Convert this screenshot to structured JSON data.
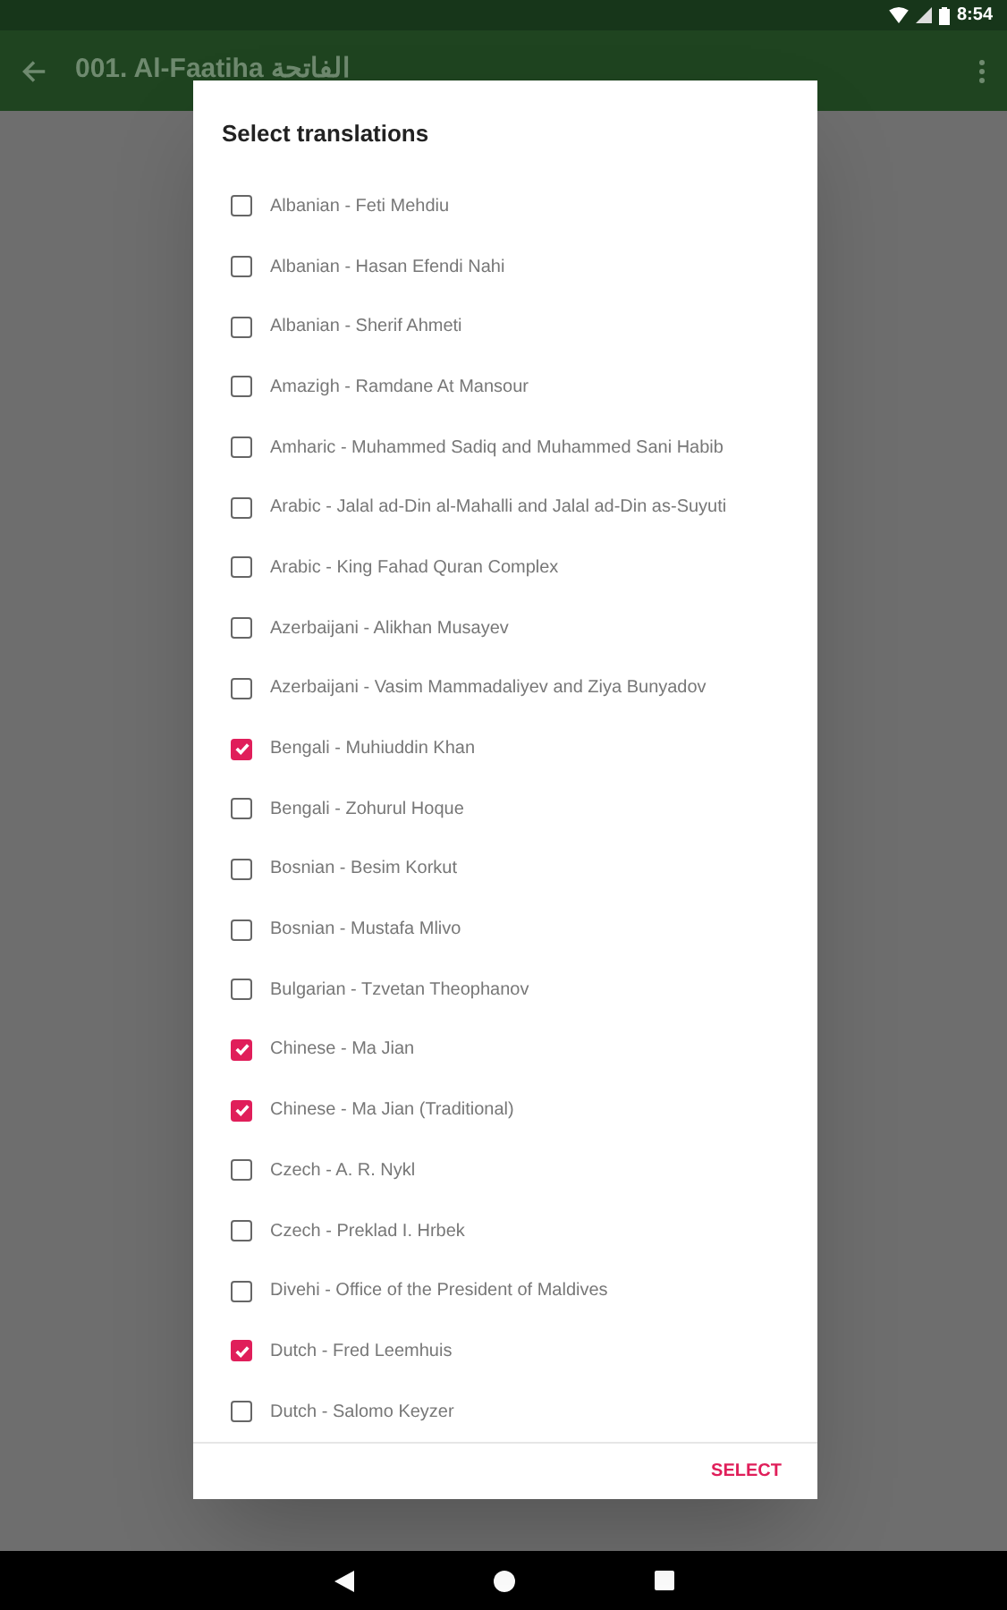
{
  "status_bar": {
    "time": "8:54"
  },
  "app_bar": {
    "title": "001. Al-Faatiha الفاتحة"
  },
  "dialog": {
    "title": "Select translations",
    "items": [
      {
        "label": "Albanian - Feti Mehdiu",
        "checked": false
      },
      {
        "label": "Albanian - Hasan Efendi Nahi",
        "checked": false
      },
      {
        "label": "Albanian - Sherif Ahmeti",
        "checked": false
      },
      {
        "label": "Amazigh - Ramdane At Mansour",
        "checked": false
      },
      {
        "label": "Amharic - Muhammed Sadiq and Muhammed Sani Habib",
        "checked": false
      },
      {
        "label": "Arabic - Jalal ad-Din al-Mahalli and Jalal ad-Din as-Suyuti",
        "checked": false
      },
      {
        "label": "Arabic - King Fahad Quran Complex",
        "checked": false
      },
      {
        "label": "Azerbaijani - Alikhan Musayev",
        "checked": false
      },
      {
        "label": "Azerbaijani - Vasim Mammadaliyev and Ziya Bunyadov",
        "checked": false
      },
      {
        "label": "Bengali - Muhiuddin Khan",
        "checked": true
      },
      {
        "label": "Bengali - Zohurul Hoque",
        "checked": false
      },
      {
        "label": "Bosnian - Besim Korkut",
        "checked": false
      },
      {
        "label": "Bosnian - Mustafa Mlivo",
        "checked": false
      },
      {
        "label": "Bulgarian - Tzvetan Theophanov",
        "checked": false
      },
      {
        "label": "Chinese - Ma Jian",
        "checked": true
      },
      {
        "label": "Chinese - Ma Jian (Traditional)",
        "checked": true
      },
      {
        "label": "Czech - A. R. Nykl",
        "checked": false
      },
      {
        "label": "Czech - Preklad I. Hrbek",
        "checked": false
      },
      {
        "label": "Divehi - Office of the President of Maldives",
        "checked": false
      },
      {
        "label": "Dutch - Fred Leemhuis",
        "checked": true
      },
      {
        "label": "Dutch - Salomo Keyzer",
        "checked": false
      }
    ],
    "button": "SELECT"
  }
}
